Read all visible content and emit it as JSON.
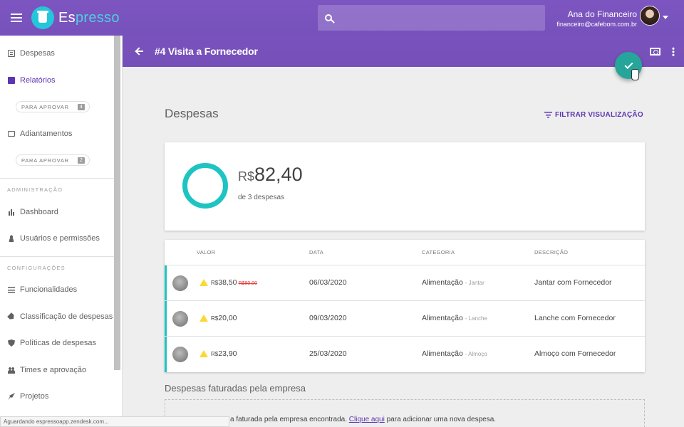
{
  "app": {
    "brand_part1": "Es",
    "brand_part2": "presso",
    "search_placeholder": "",
    "user_name": "Ana do Financeiro",
    "user_email": "financeiro@cafebom.com.br"
  },
  "sidebar": {
    "despesas": "Despesas",
    "relatorios": "Relatórios",
    "chip1_label": "PARA APROVAR",
    "chip1_count": "4",
    "adiantamentos": "Adiantamentos",
    "chip2_label": "PARA APROVAR",
    "chip2_count": "2",
    "section_admin": "ADMINISTRAÇÃO",
    "dashboard": "Dashboard",
    "usuarios": "Usuários e permissões",
    "section_config": "CONFIGURAÇÕES",
    "funcionalidades": "Funcionalidades",
    "classificacao": "Classificação de despesas",
    "politicas": "Políticas de despesas",
    "times": "Times e aprovação",
    "projetos": "Projetos"
  },
  "report": {
    "title": "#4 Visita a Fornecedor"
  },
  "main": {
    "section_title": "Despesas",
    "filter_label": "FILTRAR VISUALIZAÇÃO",
    "total_currency": "R$",
    "total_value": "82,40",
    "total_sub": "de 3 despesas",
    "columns": {
      "valor": "VALOR",
      "data": "DATA",
      "categoria": "CATEGORIA",
      "descricao": "DESCRIÇÃO"
    },
    "rows": [
      {
        "currency": "R$",
        "value": "38,50",
        "old_value": "R$80,00",
        "date": "06/03/2020",
        "category": "Alimentação",
        "subcategory": "- Jantar",
        "description": "Jantar com Fornecedor"
      },
      {
        "currency": "R$",
        "value": "20,00",
        "old_value": "",
        "date": "09/03/2020",
        "category": "Alimentação",
        "subcategory": "- Lanche",
        "description": "Lanche com Fornecedor"
      },
      {
        "currency": "R$",
        "value": "23,90",
        "old_value": "",
        "date": "25/03/2020",
        "category": "Alimentação",
        "subcategory": "- Almoço",
        "description": "Almoço com Fornecedor"
      }
    ],
    "faturadas_title": "Despesas faturadas pela empresa",
    "empty_text_before": "a faturada pela empresa encontrada.",
    "empty_link": "Clique aqui",
    "empty_text_after": "para adicionar uma nova despesa."
  },
  "status": {
    "text": "Aguardando espressoapp.zendesk.com..."
  },
  "colors": {
    "primary": "#7e57c2",
    "accent": "#26a69a",
    "teal": "#1ec4c2",
    "warning": "#fdd835"
  },
  "icons": [
    "menu-icon",
    "search-icon",
    "back-arrow-icon",
    "cash-icon",
    "more-vert-icon",
    "check-icon",
    "filter-icon",
    "warning-icon"
  ]
}
